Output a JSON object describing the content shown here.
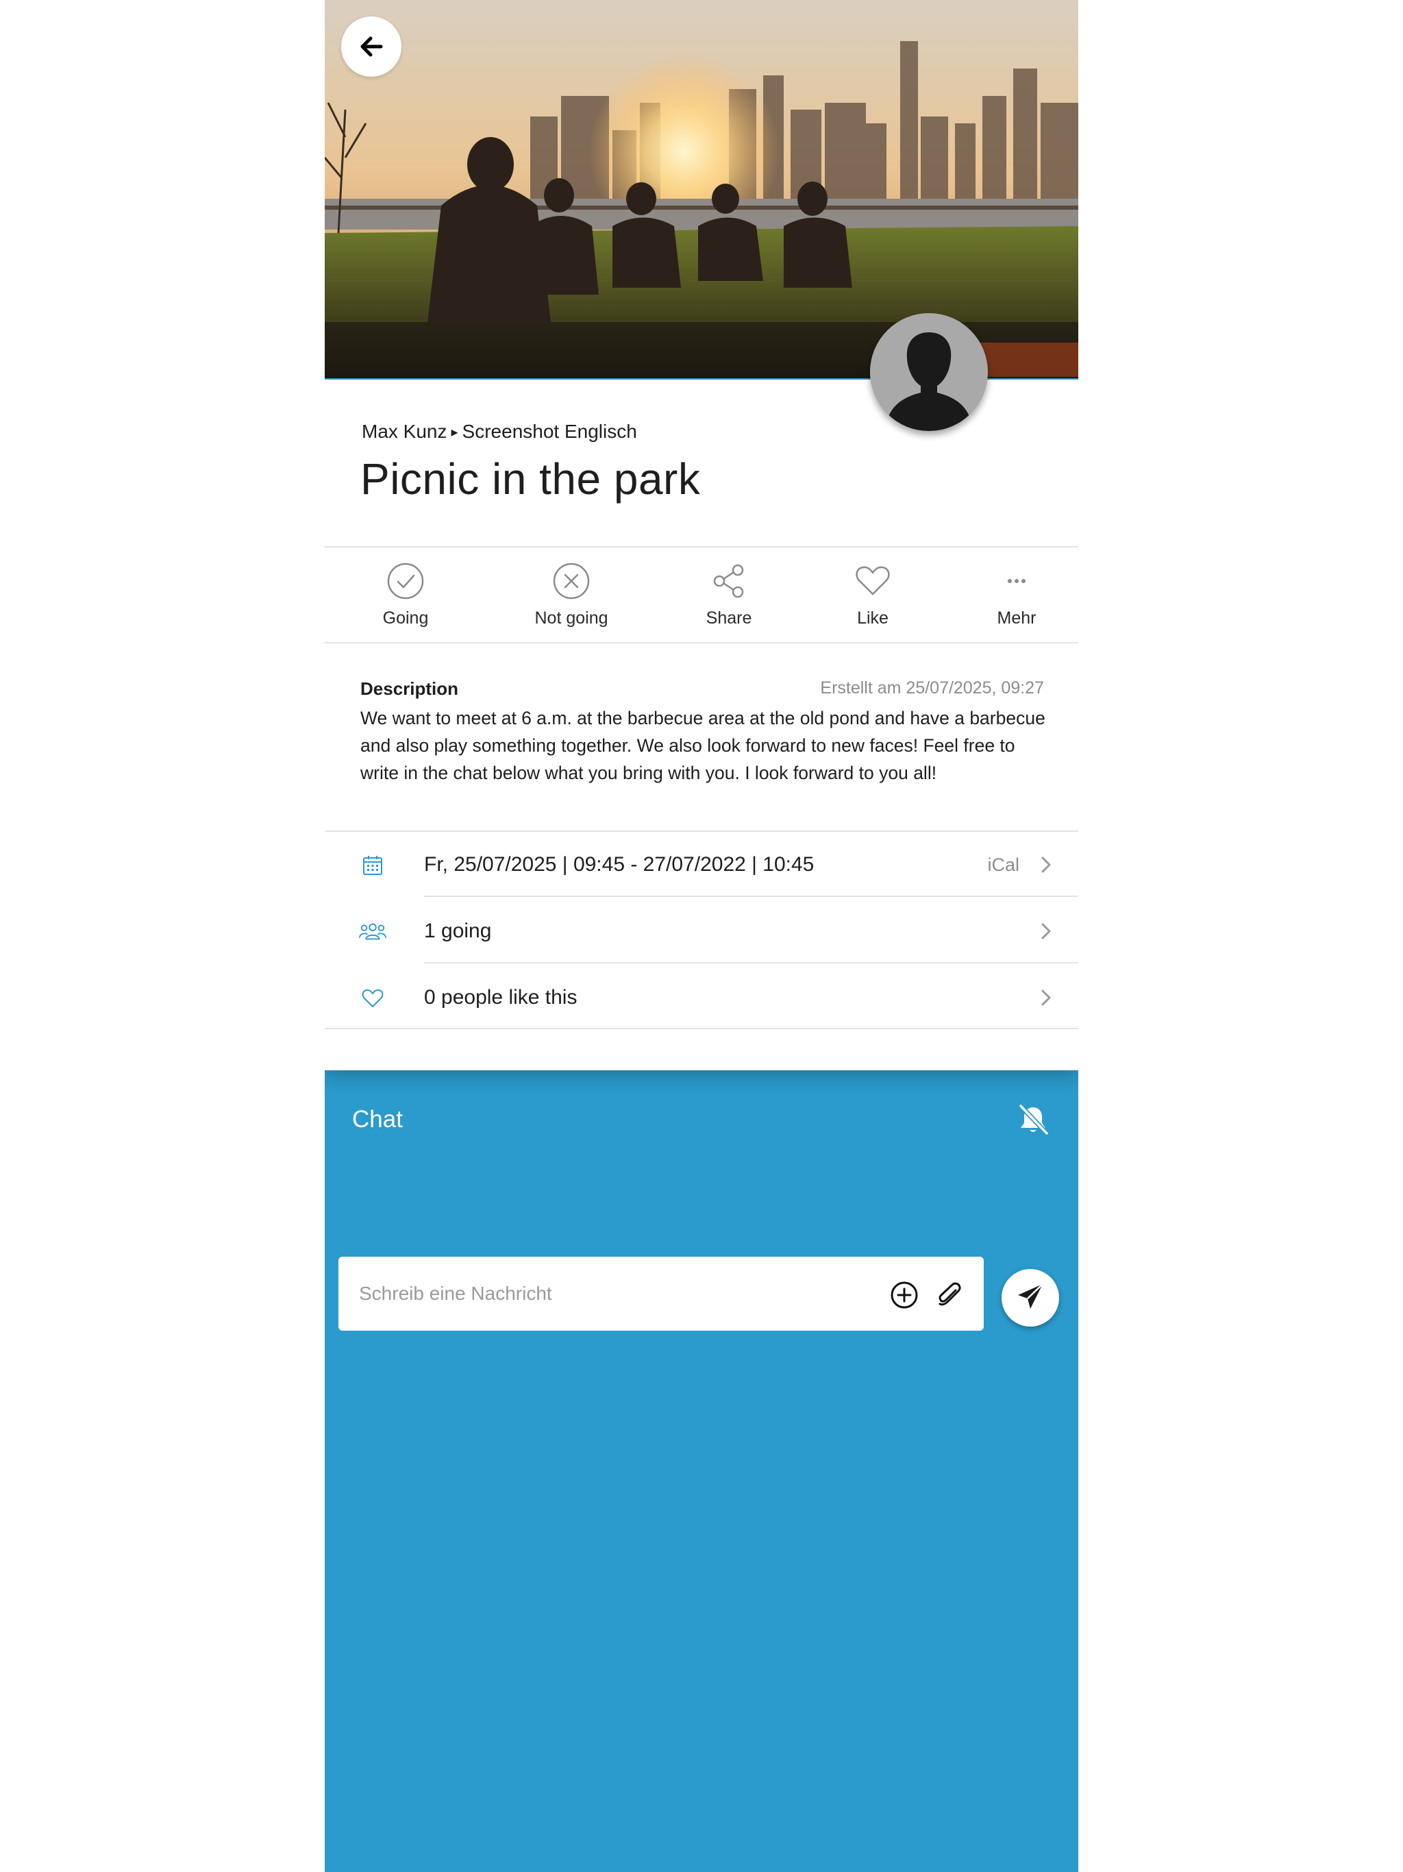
{
  "colors": {
    "accent": "#2b9acc",
    "text": "#1e1e1e",
    "muted": "#8c8c8c",
    "divider": "#e2e2e2"
  },
  "header": {
    "back_icon": "arrow-left-icon",
    "hero_image": "picnic-park-city-skyline-photo",
    "avatar": "user-placeholder-avatar"
  },
  "event": {
    "breadcrumb": {
      "author": "Max Kunz",
      "separator": "▸",
      "group": "Screenshot Englisch"
    },
    "title": "Picnic in the park"
  },
  "actions": [
    {
      "label": "Going",
      "icon": "check-circle-icon"
    },
    {
      "label": "Not going",
      "icon": "x-circle-icon"
    },
    {
      "label": "Share",
      "icon": "share-icon"
    },
    {
      "label": "Like",
      "icon": "heart-icon"
    },
    {
      "label": "Mehr",
      "icon": "more-dots-icon"
    }
  ],
  "description": {
    "heading": "Description",
    "created": "Erstellt am 25/07/2025, 09:27",
    "text": "We want to meet at 6 a.m. at the barbecue area at the old pond and have a barbecue and also play something together. We also look forward to new faces! Feel free to write in the chat below what you bring with you. I look forward to you all!"
  },
  "info_rows": {
    "date": {
      "text": "Fr, 25/07/2025 | 09:45 - 27/07/2022 | 10:45",
      "extra": "iCal",
      "icon": "calendar-icon"
    },
    "going": {
      "text": "1 going",
      "icon": "people-icon"
    },
    "likes": {
      "text": "0 people like this",
      "icon": "heart-outline-icon"
    }
  },
  "chat": {
    "title": "Chat",
    "mute_icon": "bell-off-icon",
    "placeholder": "Schreib eine Nachricht",
    "value": "",
    "plus_icon": "plus-circle-icon",
    "attach_icon": "paperclip-icon",
    "send_icon": "send-icon"
  }
}
